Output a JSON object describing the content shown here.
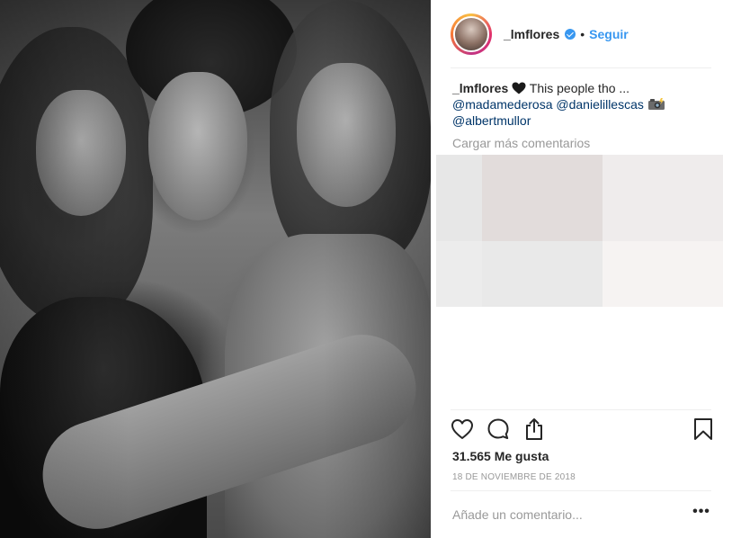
{
  "post": {
    "username": "_lmflores",
    "dot": "•",
    "follow_label": "Seguir",
    "caption": {
      "user": "_lmflores",
      "text": "This people tho ...",
      "mention1": "@madamederosa",
      "mention2": "@danielillescas",
      "mention3": "@albertmullor"
    },
    "load_more_label": "Cargar más comentarios",
    "likes": "31.565 Me gusta",
    "date": "18 DE NOVIEMBRE DE 2018",
    "comment_placeholder": "Añade un comentario...",
    "more_label": "•••"
  },
  "icons": {
    "avatar": "avatar",
    "verified": "verified-badge-icon",
    "like": "heart-outline-icon",
    "comment": "comment-bubble-icon",
    "share": "share-icon",
    "save": "bookmark-icon",
    "caption_emoji1": "black-heart-emoji",
    "caption_emoji2": "camera-flash-emoji"
  },
  "colors": {
    "link_blue": "#3897f0",
    "mention_blue": "#003569",
    "text": "#262626",
    "muted": "#999999",
    "divider": "#efefef"
  }
}
